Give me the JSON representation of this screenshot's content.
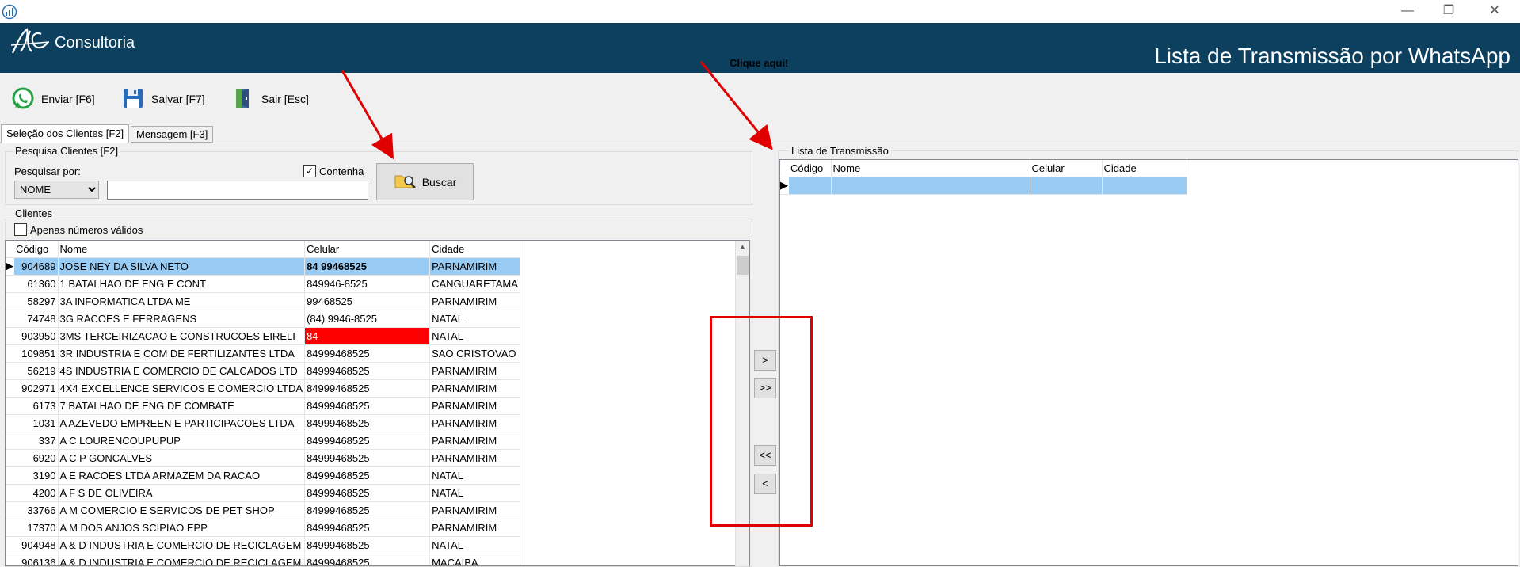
{
  "window": {
    "minimize": "—",
    "restore": "❐",
    "close": "✕"
  },
  "header": {
    "logo_text": "Consultoria",
    "title": "Lista de Transmissão por WhatsApp"
  },
  "toolbar": {
    "enviar": "Enviar [F6]",
    "salvar": "Salvar [F7]",
    "sair": "Sair [Esc]"
  },
  "annotation": {
    "clique_aqui": "Clique aqui!"
  },
  "tabs": [
    {
      "label": "Seleção dos Clientes [F2]",
      "active": true
    },
    {
      "label": "Mensagem [F3]",
      "active": false
    }
  ],
  "pesquisa": {
    "group_title": "Pesquisa Clientes [F2]",
    "label": "Pesquisar por:",
    "field_selected": "NOME",
    "search_value": "",
    "contenha_label": "Contenha",
    "contenha_checked": true,
    "buscar_label": "Buscar"
  },
  "clientes": {
    "group_title": "Clientes",
    "apenas_label": "Apenas números válidos",
    "apenas_checked": false,
    "columns": [
      "Código",
      "Nome",
      "Celular",
      "Cidade"
    ],
    "rows": [
      [
        "904689",
        " JOSE NEY DA SILVA NETO",
        "84 99468525",
        "PARNAMIRIM"
      ],
      [
        "61360",
        "1 BATALHAO DE ENG  E CONT",
        "849946-8525",
        "CANGUARETAMA"
      ],
      [
        "58297",
        "3A INFORMATICA LTDA ME",
        "99468525",
        "PARNAMIRIM"
      ],
      [
        "74748",
        "3G RACOES E FERRAGENS",
        "(84) 9946-8525",
        "NATAL"
      ],
      [
        "903950",
        "3MS TERCEIRIZACAO E CONSTRUCOES EIRELI",
        "84",
        "NATAL"
      ],
      [
        "109851",
        "3R INDUSTRIA E COM DE FERTILIZANTES LTDA",
        "84999468525",
        "SAO CRISTOVAO"
      ],
      [
        "56219",
        "4S INDUSTRIA E COMERCIO DE CALCADOS LTD",
        "84999468525",
        "PARNAMIRIM"
      ],
      [
        "902971",
        "4X4 EXCELLENCE SERVICOS E COMERCIO LTDA",
        "84999468525",
        "PARNAMIRIM"
      ],
      [
        "6173",
        "7 BATALHAO DE ENG DE COMBATE",
        "84999468525",
        "PARNAMIRIM"
      ],
      [
        "1031",
        "A  AZEVEDO EMPREEN  E PARTICIPACOES LTDA",
        "84999468525",
        "PARNAMIRIM"
      ],
      [
        "337",
        "A  C  LOURENCOUPUPUP",
        "84999468525",
        "PARNAMIRIM"
      ],
      [
        "6920",
        "A  C  P  GONCALVES",
        "84999468525",
        "PARNAMIRIM"
      ],
      [
        "3190",
        "A  E RACOES LTDA  ARMAZEM DA RACAO",
        "84999468525",
        "NATAL"
      ],
      [
        "4200",
        "A  F  S  DE OLIVEIRA",
        "84999468525",
        "NATAL"
      ],
      [
        "33766",
        "A  M  COMERCIO E SERVICOS DE PET SHOP",
        "84999468525",
        "PARNAMIRIM"
      ],
      [
        "17370",
        "A  M  DOS ANJOS SCIPIAO EPP",
        "84999468525",
        "PARNAMIRIM"
      ],
      [
        "904948",
        "A & D INDUSTRIA E COMERCIO DE RECICLAGEM",
        "84999468525",
        "NATAL"
      ],
      [
        "906136",
        "A & D INDUSTRIA E COMERCIO DE RECICLAGEM",
        "84999468525",
        "MACAIBA"
      ]
    ]
  },
  "move_buttons": {
    "add_one": ">",
    "add_all": ">>",
    "remove_all": "<<",
    "remove_one": "<"
  },
  "transmissao": {
    "group_title": "Lista de Transmissão",
    "columns": [
      "Código",
      "Nome",
      "Celular",
      "Cidade"
    ]
  },
  "colors": {
    "header_bg": "#0d3f5e",
    "selection": "#99ccf5",
    "invalid": "#ff0000",
    "annotation": "#e00000"
  }
}
